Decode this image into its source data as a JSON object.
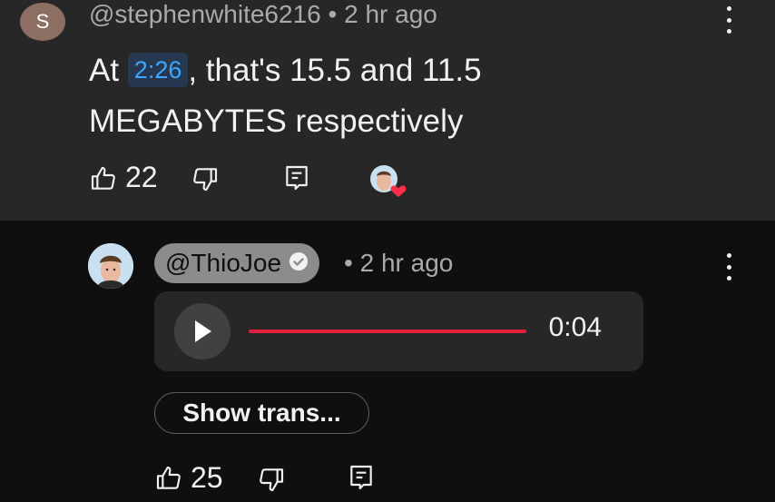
{
  "parent": {
    "avatar_letter": "S",
    "handle": "@stephenwhite6216",
    "separator": "•",
    "time": "2 hr ago",
    "text_before": "At ",
    "timestamp": "2:26",
    "text_after_line1": ", that's 15.5 and 11.5",
    "text_line2": "MEGABYTES respectively",
    "likes": "22"
  },
  "reply": {
    "handle": "@ThioJoe",
    "separator": "•",
    "time": "2 hr ago",
    "voice_duration": "0:04",
    "show_transcript_label": "Show trans...",
    "likes": "25"
  },
  "colors": {
    "top_background": "#272727",
    "page_background": "#0f0f0f",
    "timestamp_link": "#3ea6ff",
    "progress_red": "#e0203c",
    "heart": "#e0203c",
    "avatar_s": "#8d6e63"
  },
  "icons": [
    "like-icon",
    "dislike-icon",
    "reply-icon",
    "creator-heart-icon",
    "more-vert-icon",
    "verified-icon",
    "play-icon"
  ]
}
